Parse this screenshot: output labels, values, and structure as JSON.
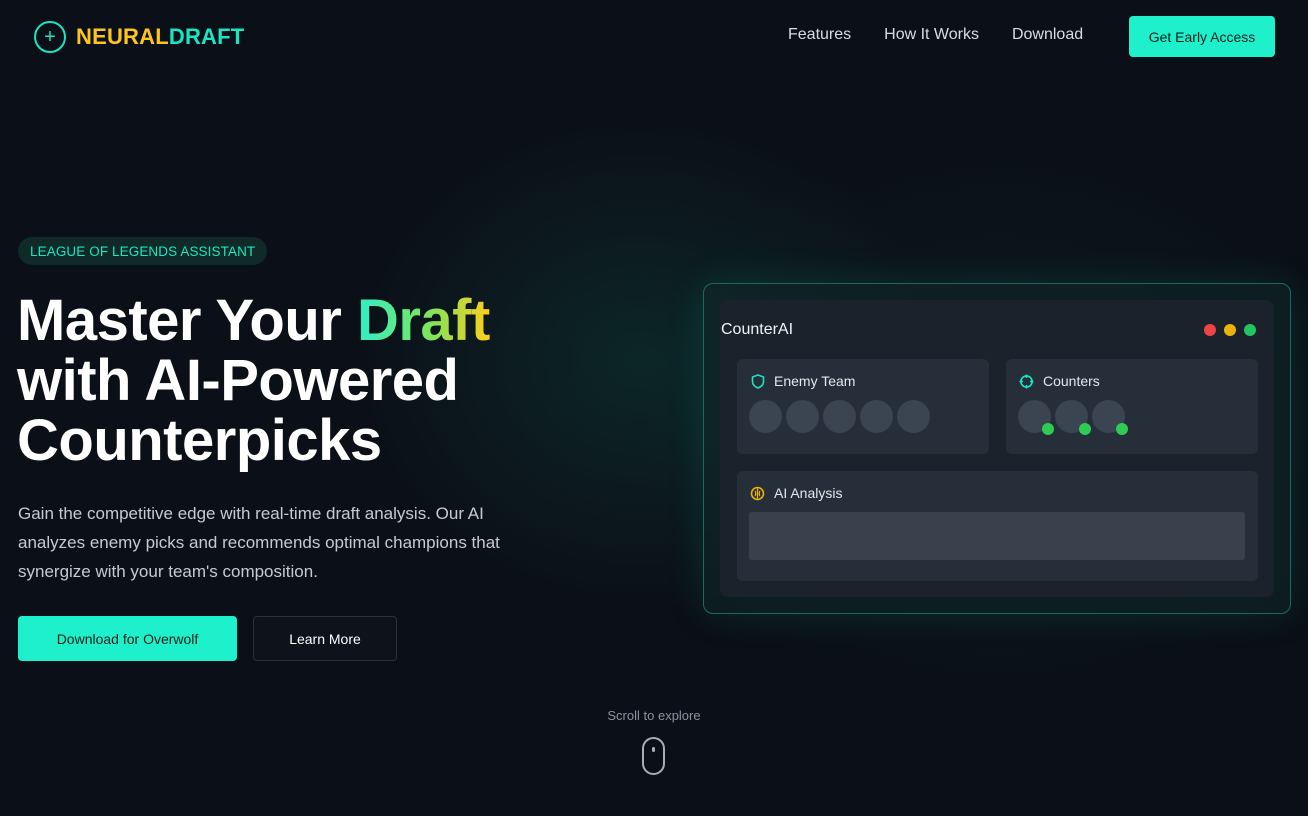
{
  "nav": {
    "logo_part1": "NEURAL",
    "logo_part2": "DRAFT",
    "links": [
      "Features",
      "How It Works",
      "Download"
    ],
    "cta": "Get Early Access"
  },
  "hero": {
    "badge": "LEAGUE OF LEGENDS ASSISTANT",
    "headline_line1_a": "Master Your ",
    "headline_line1_b": "Draft",
    "headline_line2": "with AI-Powered",
    "headline_line3": "Counterpicks",
    "subtitle": "Gain the competitive edge with real-time draft analysis. Our AI analyzes enemy picks and recommends optimal champions that synergize with your team's composition.",
    "primary_button": "Download for Overwolf",
    "secondary_button": "Learn More"
  },
  "app_preview": {
    "title": "CounterAI",
    "window_dot_colors": [
      "#ef4444",
      "#eab308",
      "#22c55e"
    ],
    "enemy_team": {
      "label": "Enemy Team",
      "icon": "shield-icon",
      "slots": 5
    },
    "counters": {
      "label": "Counters",
      "icon": "crosshair-icon",
      "slots": 3
    },
    "ai_analysis": {
      "label": "AI Analysis",
      "icon": "brain-icon"
    }
  },
  "scroll": {
    "label": "Scroll to explore",
    "icon": "mouse-icon"
  },
  "colors": {
    "accent": "#1ff0cc",
    "logo_yellow": "#ffc61a",
    "background": "#0b0f17"
  }
}
